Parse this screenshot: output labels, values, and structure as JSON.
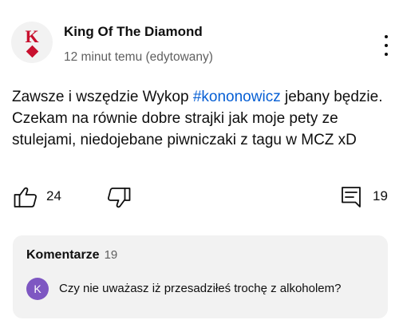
{
  "comment": {
    "avatar": {
      "letter": "K",
      "suit_icon": "diamond-icon",
      "color": "#c8102e"
    },
    "author": "King Of The Diamond",
    "meta": "12 minut temu (edytowany)",
    "text_before": "Zawsze i wszędzie Wykop ",
    "hashtag": "#kononowicz",
    "text_after": " jebany będzie. Czekam na równie dobre strajki jak moje pety ze stulejami, niedojebane piwniczaki z tagu w MCZ xD",
    "hashtag_color": "#065fd4"
  },
  "actions": {
    "like_icon": "thumbs-up-icon",
    "like_count": "24",
    "dislike_icon": "thumbs-down-icon",
    "reply_icon": "comment-icon",
    "reply_count": "19"
  },
  "comments_panel": {
    "title": "Komentarze",
    "count": "19",
    "preview": {
      "avatar_letter": "K",
      "avatar_color": "#7e57c2",
      "text": "Czy nie uważasz iż przesadziłeś trochę z alkoholem?"
    }
  }
}
